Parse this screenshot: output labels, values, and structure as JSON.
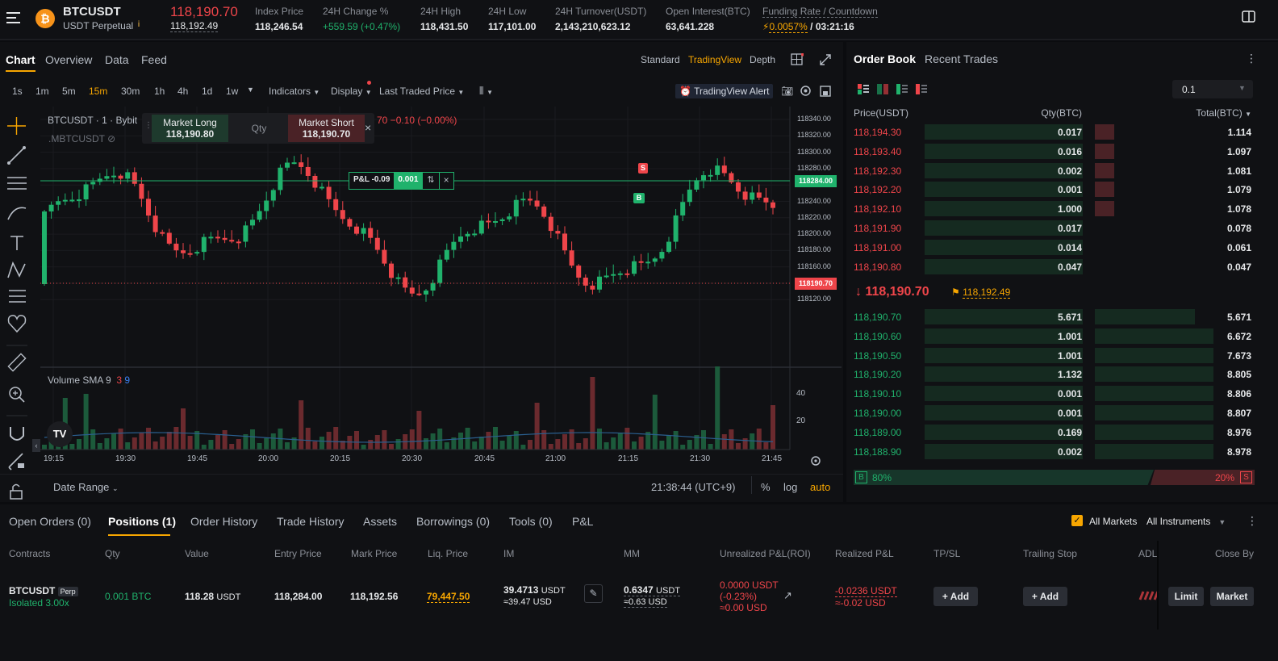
{
  "header": {
    "symbol": "BTCUSDT",
    "subtitle": "USDT Perpetual",
    "last_price": "118,190.70",
    "mark_price": "118,192.49",
    "stats": [
      {
        "label": "Index Price",
        "value": "118,246.54"
      },
      {
        "label": "24H Change %",
        "value": "+559.59 (+0.47%)"
      },
      {
        "label": "24H High",
        "value": "118,431.50"
      },
      {
        "label": "24H Low",
        "value": "117,101.00"
      },
      {
        "label": "24H Turnover(USDT)",
        "value": "2,143,210,623.12"
      },
      {
        "label": "Open Interest(BTC)",
        "value": "63,641.228"
      }
    ],
    "funding_label": "Funding Rate / Countdown",
    "funding_rate": "0.0057%",
    "countdown": "/ 03:21:16"
  },
  "chart_tabs": [
    "Chart",
    "Overview",
    "Data",
    "Feed"
  ],
  "view_modes": [
    "Standard",
    "TradingView",
    "Depth"
  ],
  "intervals": [
    "1s",
    "1m",
    "5m",
    "15m",
    "30m",
    "1h",
    "4h",
    "1d",
    "1w"
  ],
  "toolbar": {
    "indicators": "Indicators",
    "display": "Display",
    "last_traded": "Last Traded Price",
    "tv_alert": "TradingView Alert"
  },
  "legend": {
    "title": "BTCUSDT · 1 · Bybit",
    "change": "70 −0.10 (−0.00%)",
    "sub": ".MBTCUSDT"
  },
  "trade_widget": {
    "long_label": "Market Long",
    "long_price": "118,190.80",
    "qty": "Qty",
    "short_label": "Market Short",
    "short_price": "118,190.70"
  },
  "position_line": {
    "pnl": "P&L -0.09",
    "qty": "0.001",
    "price_tag": "118284.00"
  },
  "current_tag": "118190.70",
  "markers": {
    "sell": "S",
    "buy": "B"
  },
  "price_axis": [
    "118340.00",
    "118320.00",
    "118300.00",
    "118280.00",
    "118260.00",
    "118240.00",
    "118220.00",
    "118200.00",
    "118180.00",
    "118160.00",
    "118140.00",
    "118120.00"
  ],
  "volume": {
    "label": "Volume SMA 9",
    "v1": "3",
    "v2": "9",
    "axis": [
      "40",
      "20"
    ]
  },
  "time_axis": [
    "19:15",
    "19:30",
    "19:45",
    "20:00",
    "20:15",
    "20:30",
    "20:45",
    "21:00",
    "21:15",
    "21:30",
    "21:45"
  ],
  "chart_footer": {
    "date_range": "Date Range",
    "clock": "21:38:44 (UTC+9)",
    "pct": "%",
    "log": "log",
    "auto": "auto"
  },
  "orderbook": {
    "tabs": [
      "Order Book",
      "Recent Trades"
    ],
    "step": "0.1",
    "headers": [
      "Price(USDT)",
      "Qty(BTC)",
      "Total(BTC)"
    ],
    "asks": [
      {
        "price": "118,194.30",
        "qty": "0.017",
        "total": "1.114"
      },
      {
        "price": "118,193.40",
        "qty": "0.016",
        "total": "1.097"
      },
      {
        "price": "118,192.30",
        "qty": "0.002",
        "total": "1.081"
      },
      {
        "price": "118,192.20",
        "qty": "0.001",
        "total": "1.079"
      },
      {
        "price": "118,192.10",
        "qty": "1.000",
        "total": "1.078"
      },
      {
        "price": "118,191.90",
        "qty": "0.017",
        "total": "0.078"
      },
      {
        "price": "118,191.00",
        "qty": "0.014",
        "total": "0.061"
      },
      {
        "price": "118,190.80",
        "qty": "0.047",
        "total": "0.047"
      }
    ],
    "mid_price": "118,190.70",
    "mid_mark": "118,192.49",
    "bids": [
      {
        "price": "118,190.70",
        "qty": "5.671",
        "total": "5.671"
      },
      {
        "price": "118,190.60",
        "qty": "1.001",
        "total": "6.672"
      },
      {
        "price": "118,190.50",
        "qty": "1.001",
        "total": "7.673"
      },
      {
        "price": "118,190.20",
        "qty": "1.132",
        "total": "8.805"
      },
      {
        "price": "118,190.10",
        "qty": "0.001",
        "total": "8.806"
      },
      {
        "price": "118,190.00",
        "qty": "0.001",
        "total": "8.807"
      },
      {
        "price": "118,189.00",
        "qty": "0.169",
        "total": "8.976"
      },
      {
        "price": "118,188.90",
        "qty": "0.002",
        "total": "8.978"
      }
    ],
    "buy_label": "B",
    "buy_pct": "80%",
    "sell_pct": "20%",
    "sell_label": "S"
  },
  "bottom": {
    "tabs": [
      "Open Orders (0)",
      "Positions (1)",
      "Order History",
      "Trade History",
      "Assets",
      "Borrowings (0)",
      "Tools (0)",
      "P&L"
    ],
    "all_markets": "All Markets",
    "all_instruments": "All Instruments",
    "headers": [
      "Contracts",
      "Qty",
      "Value",
      "Entry Price",
      "Mark Price",
      "Liq. Price",
      "IM",
      "MM",
      "Unrealized P&L(ROI)",
      "Realized P&L",
      "TP/SL",
      "Trailing Stop",
      "ADL",
      "Close By"
    ],
    "row": {
      "symbol": "BTCUSDT",
      "badge": "Perp",
      "margin": "Isolated 3.00x",
      "qty": "0.001 BTC",
      "value": "118.28",
      "value_unit": "USDT",
      "entry": "118,284.00",
      "mark": "118,192.56",
      "liq": "79,447.50",
      "im1": "39.4713",
      "im_unit": "USDT",
      "im2": "≈39.47 USD",
      "mm1": "0.6347",
      "mm_unit": "USDT",
      "mm2": "≈0.63 USD",
      "upnl1": "0.0000 USDT",
      "upnl2": "(-0.23%)",
      "upnl3": "≈0.00 USD",
      "rpnl1": "-0.0236 USDT",
      "rpnl2": "≈-0.02 USD",
      "tpsl": "Add",
      "trailing": "Add",
      "limit": "Limit",
      "market": "Market"
    }
  }
}
